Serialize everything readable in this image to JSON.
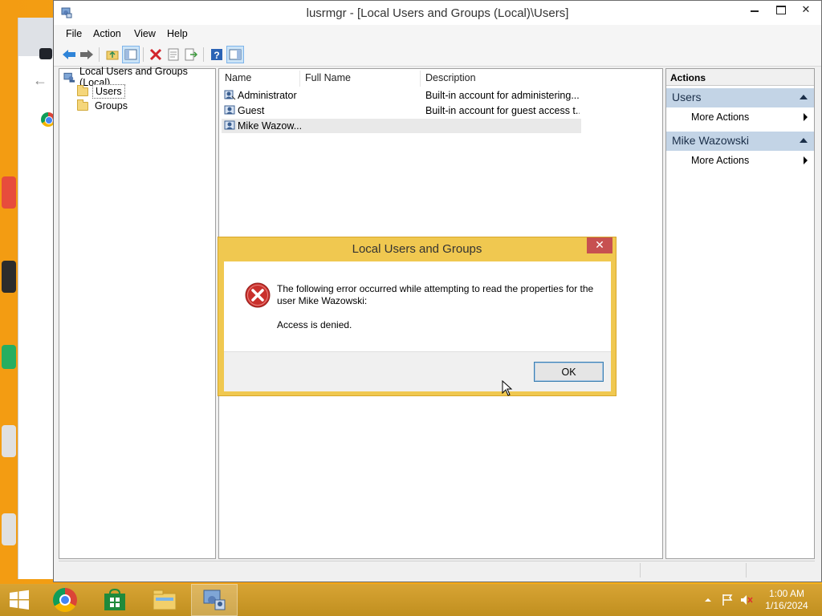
{
  "window": {
    "title": "lusrmgr - [Local Users and Groups (Local)\\Users]"
  },
  "menu": [
    "File",
    "Action",
    "View",
    "Help"
  ],
  "toolbar_icons": [
    "back-arrow-icon",
    "forward-arrow-icon",
    "up-folder-icon",
    "show-hide-tree-icon",
    "delete-icon",
    "properties-icon",
    "export-list-icon",
    "help-icon",
    "show-hide-action-pane-icon"
  ],
  "tree": {
    "root": "Local Users and Groups (Local)",
    "items": [
      "Users",
      "Groups"
    ],
    "selected": "Users"
  },
  "list": {
    "columns": [
      "Name",
      "Full Name",
      "Description"
    ],
    "rows": [
      {
        "name": "Administrator",
        "full_name": "",
        "description": "Built-in account for administering..."
      },
      {
        "name": "Guest",
        "full_name": "",
        "description": "Built-in account for guest access t..."
      },
      {
        "name": "Mike Wazow...",
        "full_name": "",
        "description": ""
      }
    ]
  },
  "actions": {
    "header": "Actions",
    "sections": [
      {
        "title": "Users",
        "item": "More Actions"
      },
      {
        "title": "Mike Wazowski",
        "item": "More Actions"
      }
    ]
  },
  "dialog": {
    "title": "Local Users and Groups",
    "close_glyph": "✕",
    "message": "The following error occurred while attempting to read the properties for the user Mike Wazowski:",
    "detail": "Access is denied.",
    "ok_label": "OK"
  },
  "taskbar": {
    "time": "1:00 AM",
    "date": "1/16/2024",
    "apps": [
      "chrome-icon",
      "store-icon",
      "file-explorer-icon",
      "lusrmgr-icon"
    ]
  },
  "colors": {
    "dialog_frame": "#f0c850",
    "taskbar": "#c79622",
    "action_section": "#c3d4e6",
    "close_button": "#c75050"
  }
}
